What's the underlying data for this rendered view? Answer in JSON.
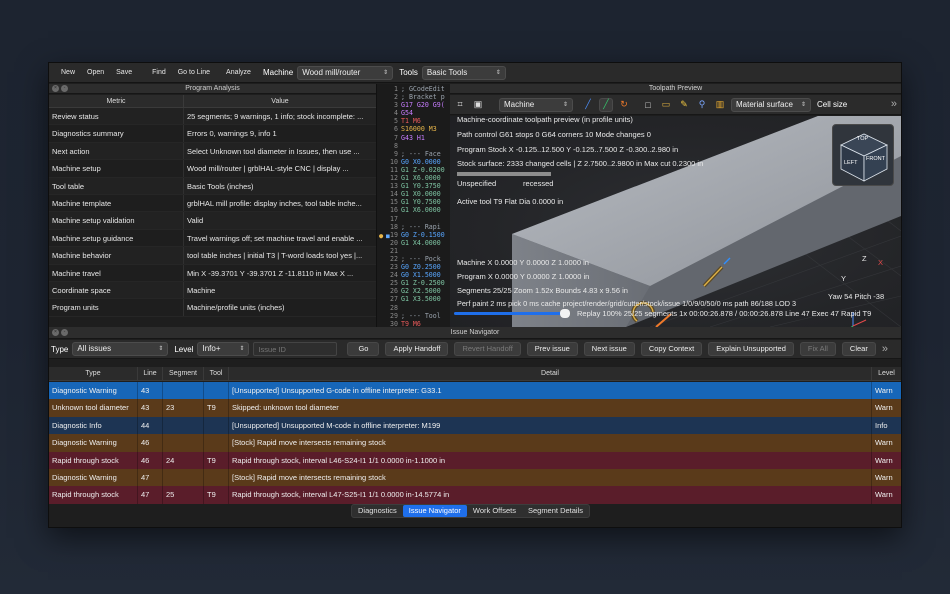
{
  "toolbar": {
    "buttons": [
      "New",
      "Open",
      "Save",
      "Find",
      "Go to Line",
      "Analyze"
    ],
    "machine_label": "Machine",
    "machine_value": "Wood mill/router",
    "tools_label": "Tools",
    "tools_value": "Basic Tools"
  },
  "program_analysis": {
    "title": "Program Analysis",
    "col_metric": "Metric",
    "col_value": "Value",
    "rows": [
      {
        "metric": "Review status",
        "value": "25 segments; 9 warnings, 1 info; stock incomplete: ..."
      },
      {
        "metric": "Diagnostics summary",
        "value": "Errors 0, warnings 9, info 1"
      },
      {
        "metric": "Next action",
        "value": "Select Unknown tool diameter in Issues, then use ..."
      },
      {
        "metric": "Machine setup",
        "value": "Wood mill/router | grblHAL-style CNC | display ..."
      },
      {
        "metric": "Tool table",
        "value": "Basic Tools (inches)"
      },
      {
        "metric": "Machine template",
        "value": "grblHAL mill profile: display inches, tool table inche..."
      },
      {
        "metric": "Machine setup validation",
        "value": "Valid"
      },
      {
        "metric": "Machine setup guidance",
        "value": "Travel warnings off; set machine travel and enable ..."
      },
      {
        "metric": "Machine behavior",
        "value": "tool table inches | initial T3 | T-word loads tool yes |..."
      },
      {
        "metric": "Machine travel",
        "value": "Min X -39.3701  Y -39.3701  Z -11.8110 in    Max X ..."
      },
      {
        "metric": "Coordinate space",
        "value": "Machine"
      },
      {
        "metric": "Program units",
        "value": "Machine/profile units (inches)"
      }
    ]
  },
  "editor": {
    "lines": [
      {
        "n": "1",
        "t": "; GCodeEdit"
      },
      {
        "n": "2",
        "t": "; Bracket p"
      },
      {
        "n": "3",
        "t": "G17 G20 G9("
      },
      {
        "n": "4",
        "t": "G54"
      },
      {
        "n": "5",
        "t": "T1 M6"
      },
      {
        "n": "6",
        "t": "S16000 M3"
      },
      {
        "n": "7",
        "t": "G43 H1"
      },
      {
        "n": "8",
        "t": ""
      },
      {
        "n": "9",
        "t": "; --- Face"
      },
      {
        "n": "10",
        "t": "G0 X0.0000"
      },
      {
        "n": "11",
        "t": "G1 Z-0.0200"
      },
      {
        "n": "12",
        "t": "G1 X6.0000"
      },
      {
        "n": "13",
        "t": "G1 Y0.3750"
      },
      {
        "n": "14",
        "t": "G1 X0.0000"
      },
      {
        "n": "15",
        "t": "G1 Y0.7500"
      },
      {
        "n": "16",
        "t": "G1 X6.0000"
      },
      {
        "n": "17",
        "t": ""
      },
      {
        "n": "18",
        "t": "; --- Rapi"
      },
      {
        "n": "19",
        "t": "G0 Z-0.1500"
      },
      {
        "n": "20",
        "t": "G1 X4.0000"
      },
      {
        "n": "21",
        "t": ""
      },
      {
        "n": "22",
        "t": "; --- Pock"
      },
      {
        "n": "23",
        "t": "G0 Z0.2500"
      },
      {
        "n": "24",
        "t": "G0 X1.5000"
      },
      {
        "n": "25",
        "t": "G1 Z-0.2500"
      },
      {
        "n": "26",
        "t": "G2 X2.5000"
      },
      {
        "n": "27",
        "t": "G1 X3.5000"
      },
      {
        "n": "28",
        "t": ""
      },
      {
        "n": "29",
        "t": "; --- Tool"
      },
      {
        "n": "30",
        "t": "T9 M6"
      }
    ]
  },
  "toolpath": {
    "title": "Toolpath Preview",
    "view_select": "Machine",
    "material_select": "Material surface",
    "cell_size_label": "Cell size",
    "info": [
      "Machine-coordinate toolpath preview (in profile units)",
      "Path control  G61 stops 0    G64 corners 10    Mode changes 0",
      "Program Stock  X -0.125..12.500  Y -0.125..7.500  Z -0.300..2.980 in",
      "Stock surface: 2333 changed cells   |   Z 2.7500..2.9800 in   Max cut 0.2300 in"
    ],
    "legend_unspecified": "Unspecified",
    "legend_recessed": "recessed",
    "active_tool": "Active tool T9   Flat   Dia 0.0000 in",
    "machine_pos": "Machine X 0.0000   Y 0.0000   Z 1.0000 in",
    "program_pos": "Program X 0.0000   Y 0.0000   Z 1.0000 in",
    "segments": "Segments 25/25   Zoom 1.52x   Bounds 4.83 x 9.56 in",
    "perf": "Perf paint 2 ms   pick 0 ms   cache project/render/grid/cutter/stock/issue 1/0/9/0/50/0 ms   path 86/188 LOD 3",
    "replay": "Replay 100%   25/25 segments   1x   00:00:26.878 / 00:00:26.878   Line 47   Exec 47   Rapid   T9",
    "replay_fraction": 1.0,
    "yaw_pitch": "Yaw 54   Pitch -38",
    "cube_top": "TOP",
    "cube_left": "LEFT",
    "cube_front": "FRONT",
    "axis_x": "X",
    "axis_y": "Y",
    "axis_z": "Z"
  },
  "issues": {
    "title": "Issue Navigator",
    "type_label": "Type",
    "type_value": "All issues",
    "level_label": "Level",
    "level_value": "Info+",
    "issue_id_placeholder": "Issue ID",
    "buttons": {
      "go": "Go",
      "apply": "Apply Handoff",
      "revert": "Revert Handoff",
      "prev": "Prev issue",
      "next": "Next issue",
      "copy": "Copy Context",
      "explain": "Explain Unsupported",
      "fixall": "Fix All",
      "clear": "Clear"
    },
    "columns": [
      "Type",
      "Line",
      "Segment",
      "Tool",
      "Detail",
      "Level"
    ],
    "rows": [
      {
        "type": "Diagnostic Warning",
        "line": "43",
        "segment": "",
        "tool": "",
        "detail": "[Unsupported] Unsupported G-code in offline interpreter: G33.1",
        "level": "Warn",
        "color": "#1766b8"
      },
      {
        "type": "Unknown tool diameter",
        "line": "43",
        "segment": "23",
        "tool": "T9",
        "detail": "Skipped: unknown tool diameter",
        "level": "Warn",
        "color": "#5a3a1a"
      },
      {
        "type": "Diagnostic Info",
        "line": "44",
        "segment": "",
        "tool": "",
        "detail": "[Unsupported] Unsupported M-code in offline interpreter: M199",
        "level": "Info",
        "color": "#1d3453"
      },
      {
        "type": "Diagnostic Warning",
        "line": "46",
        "segment": "",
        "tool": "",
        "detail": "[Stock] Rapid move intersects remaining stock",
        "level": "Warn",
        "color": "#5a3a1a"
      },
      {
        "type": "Rapid through stock",
        "line": "46",
        "segment": "24",
        "tool": "T9",
        "detail": "Rapid through stock, interval L46-S24-I1 1/1 0.0000 in-1.1000 in",
        "level": "Warn",
        "color": "#5a1d2a"
      },
      {
        "type": "Diagnostic Warning",
        "line": "47",
        "segment": "",
        "tool": "",
        "detail": "[Stock] Rapid move intersects remaining stock",
        "level": "Warn",
        "color": "#5a3a1a"
      },
      {
        "type": "Rapid through stock",
        "line": "47",
        "segment": "25",
        "tool": "T9",
        "detail": "Rapid through stock, interval L47-S25-I1 1/1 0.0000 in-14.5774 in",
        "level": "Warn",
        "color": "#5a1d2a"
      }
    ],
    "tabs": [
      "Diagnostics",
      "Issue Navigator",
      "Work Offsets",
      "Segment Details"
    ],
    "active_tab": "Issue Navigator"
  }
}
